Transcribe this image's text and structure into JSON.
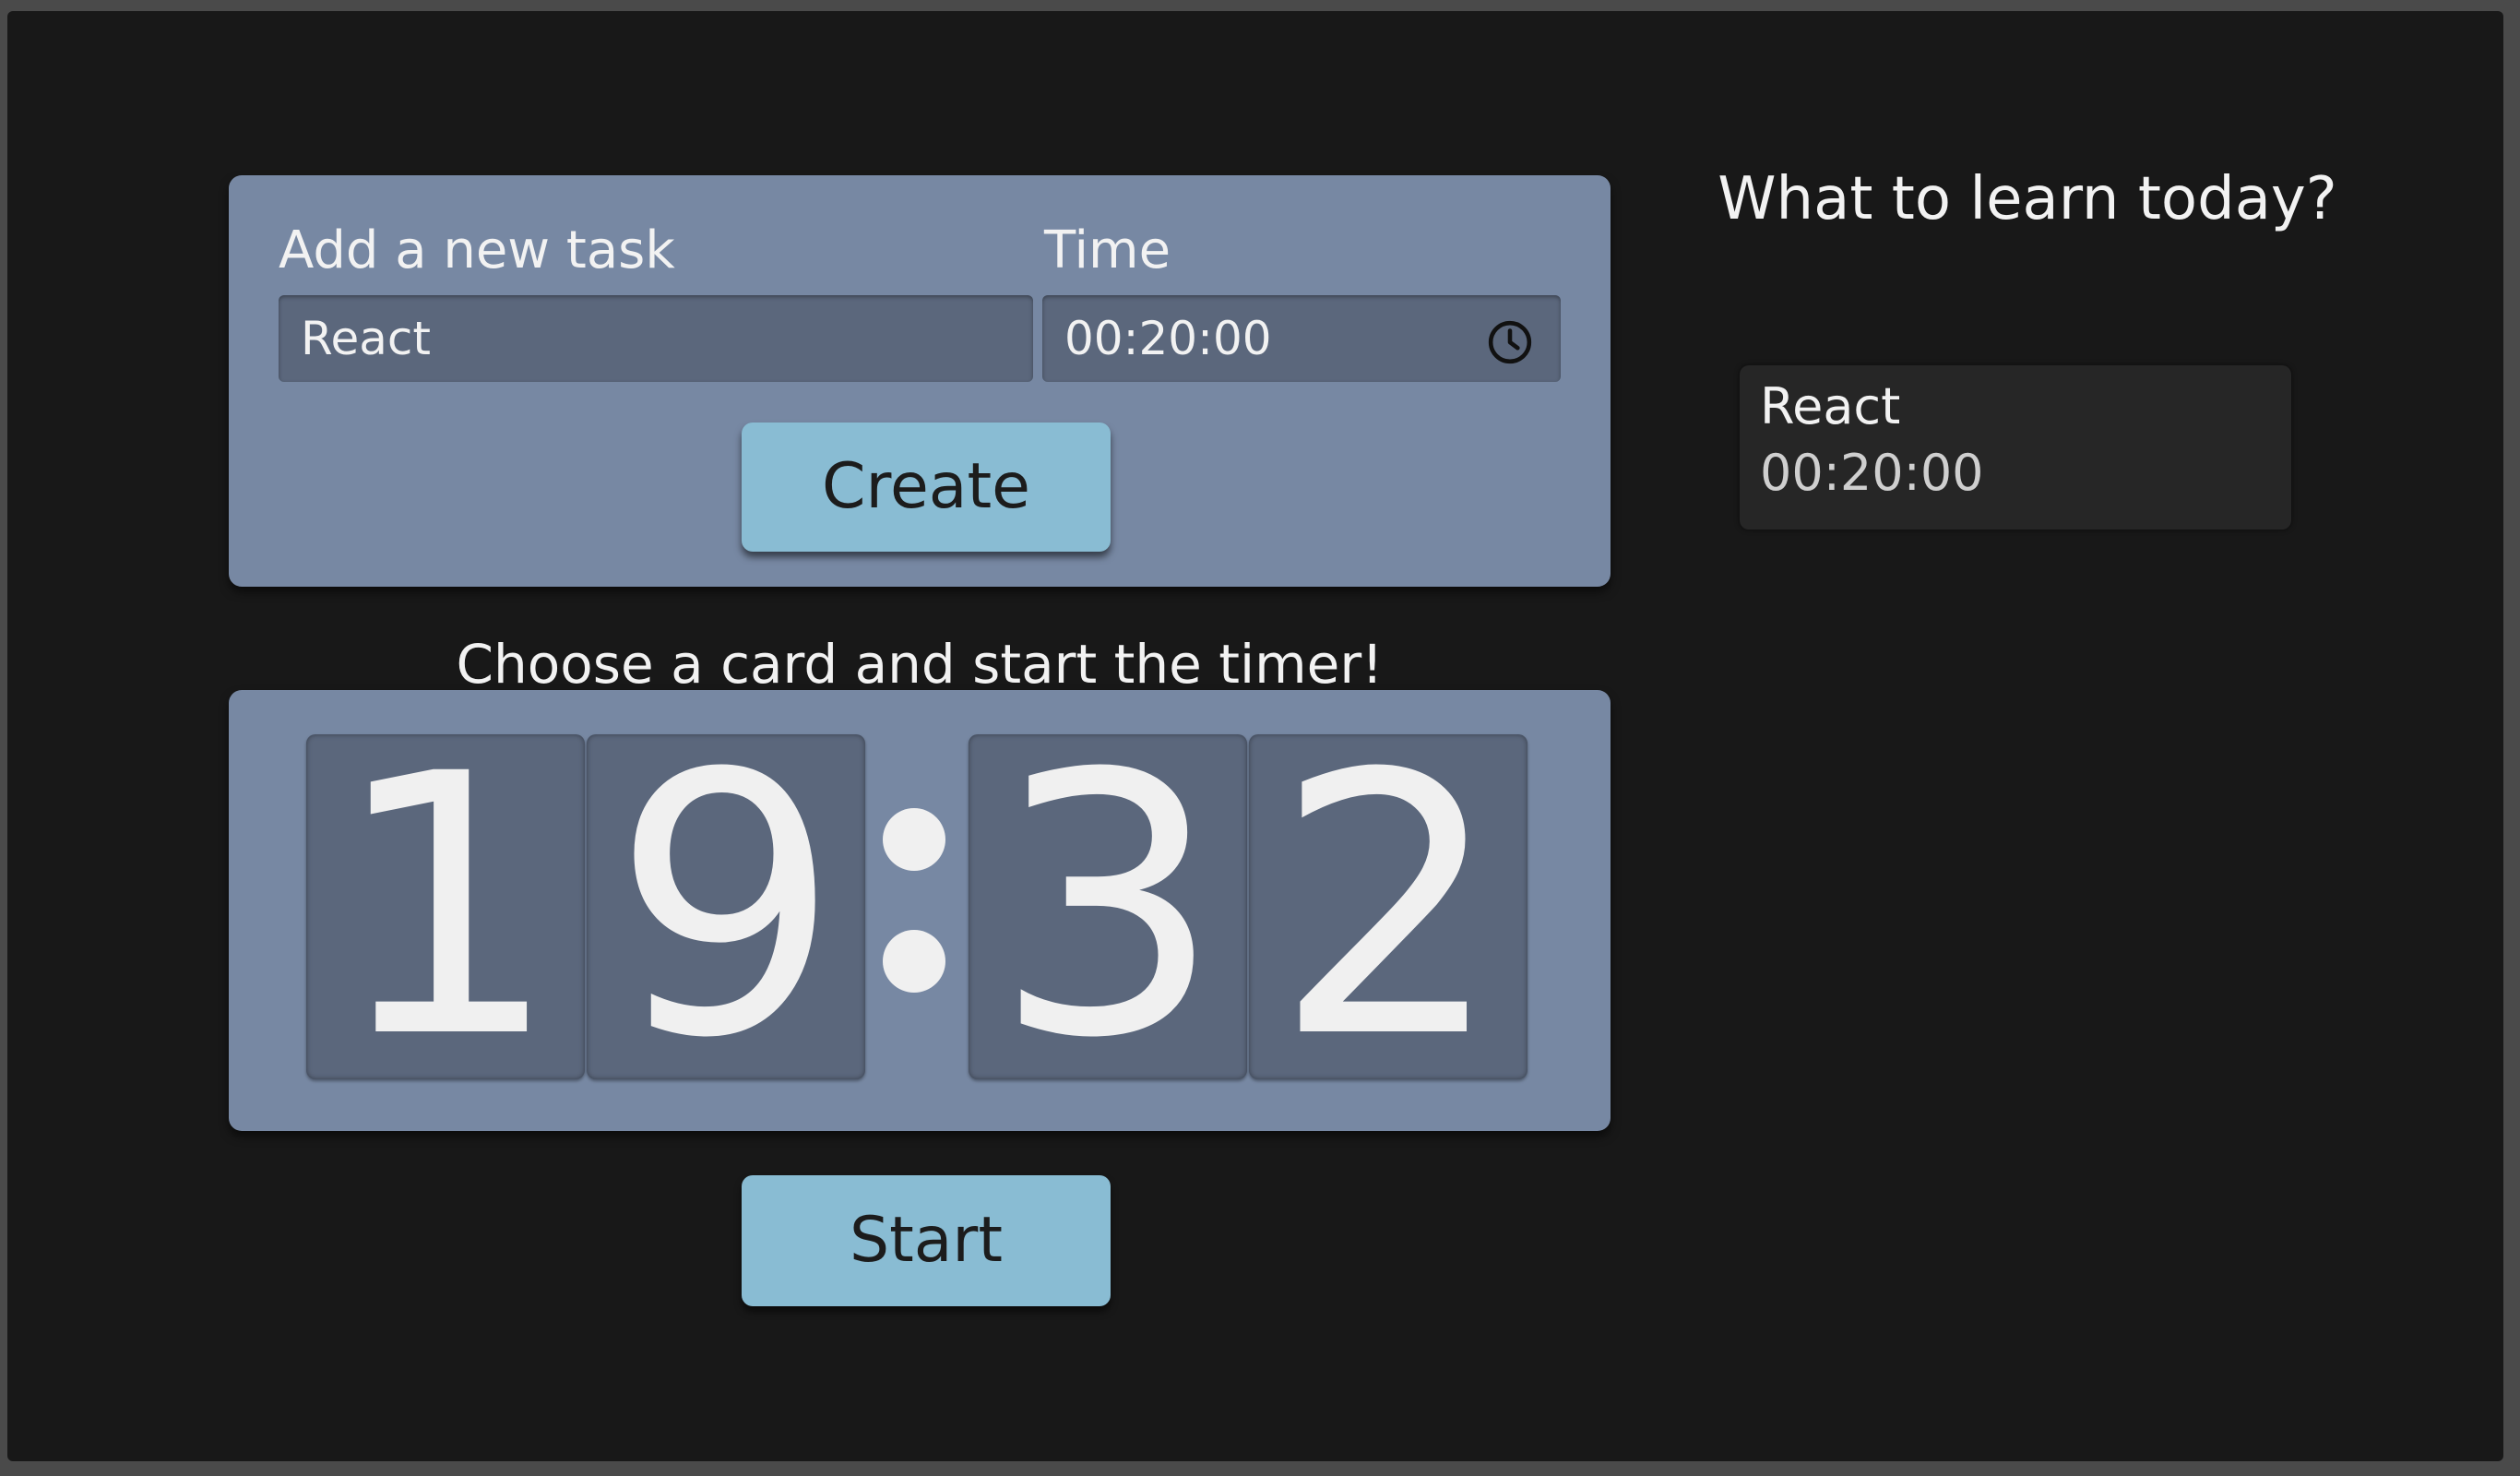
{
  "form": {
    "task_label": "Add a new task",
    "time_label": "Time",
    "task_value": "React",
    "time_value": "00:20:00",
    "create_label": "Create"
  },
  "timer": {
    "caption": "Choose a card and start the timer!",
    "digits": [
      "1",
      "9",
      "3",
      "2"
    ],
    "start_label": "Start"
  },
  "sidebar": {
    "title": "What to learn today?",
    "tasks": [
      {
        "name": "React",
        "time": "00:20:00"
      }
    ]
  },
  "icons": {
    "time_field": "clock-icon"
  },
  "colors": {
    "background": "#181818",
    "panel": "#7788a3",
    "field": "#5b677c",
    "button": "#89bcd3",
    "card": "#262626"
  }
}
